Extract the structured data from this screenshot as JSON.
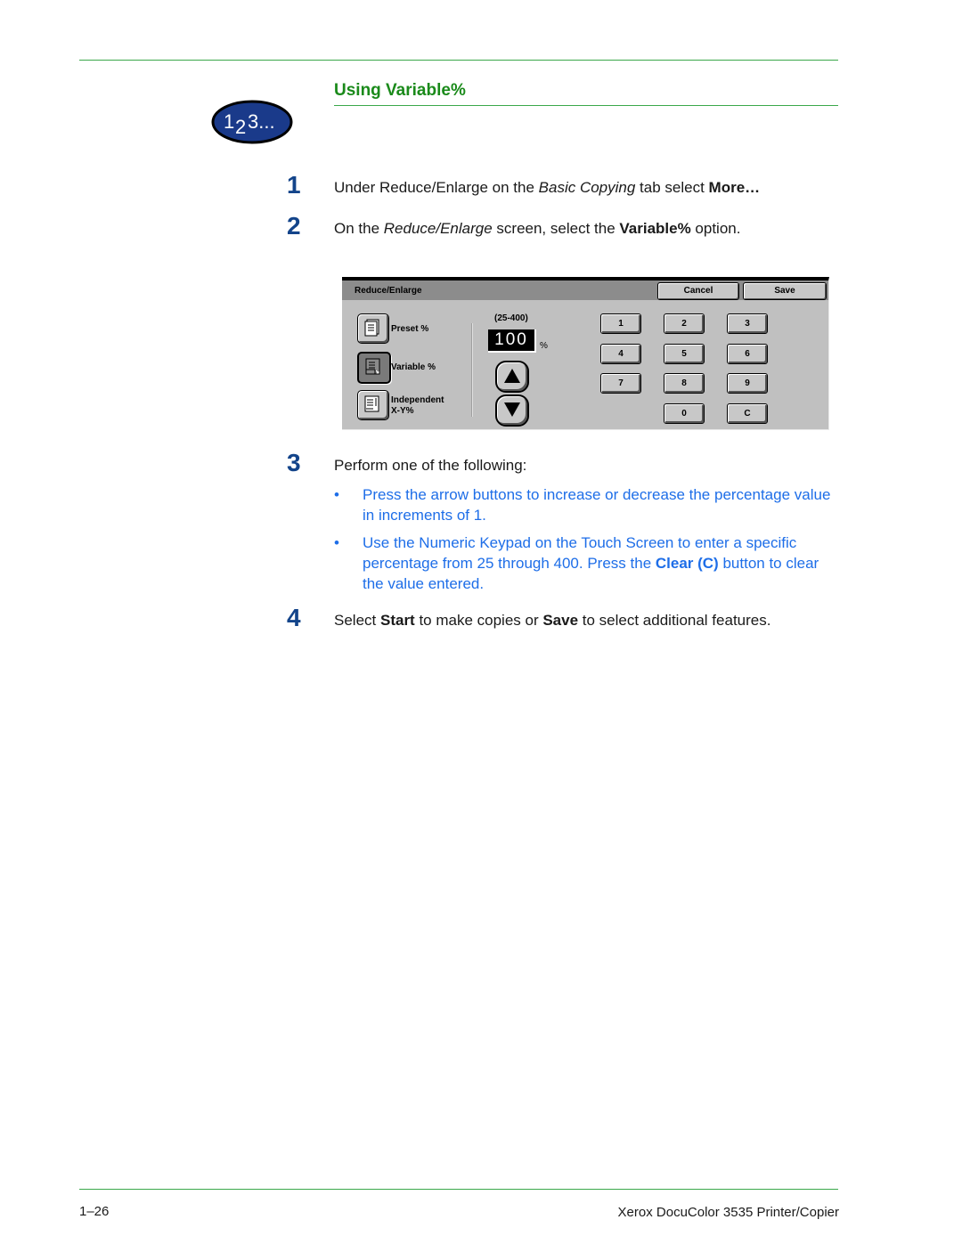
{
  "section": {
    "title": "Using Variable%",
    "badge_text": "123..."
  },
  "steps": [
    {
      "number": "1",
      "parts": {
        "a": "Under Reduce/Enlarge on the ",
        "b_italic": "Basic Copying",
        "c": " tab select ",
        "d_bold": "More…"
      }
    },
    {
      "number": "2",
      "parts": {
        "a": "On the ",
        "b_italic": "Reduce/Enlarge",
        "c": " screen, select the ",
        "d_bold": "Variable%",
        "e": " option."
      }
    },
    {
      "number": "3",
      "text": "Perform one of the following:"
    },
    {
      "number": "4",
      "parts": {
        "a": "Select ",
        "b_bold": "Start",
        "c": " to make copies or ",
        "d_bold": "Save",
        "e": " to select additional features."
      }
    }
  ],
  "bullets": [
    {
      "marker": "•",
      "text": "Press the arrow buttons to increase or decrease the percentage value in increments of 1."
    },
    {
      "marker": "•",
      "text_a": "Use the Numeric Keypad on the Touch Screen to enter a specific percentage from 25 through 400.  Press the ",
      "text_bold": "Clear (C)",
      "text_b": " button to clear the value entered."
    }
  ],
  "screen": {
    "title": "Reduce/Enlarge",
    "cancel_label": "Cancel",
    "save_label": "Save",
    "options": [
      {
        "label_line1": "Preset  %",
        "label_line2": "",
        "selected": false
      },
      {
        "label_line1": "Variable  %",
        "label_line2": "",
        "selected": true
      },
      {
        "label_line1": "Independent",
        "label_line2": "X-Y%",
        "selected": false
      }
    ],
    "range_label": "(25-400)",
    "value": "100",
    "unit": "%",
    "keypad": [
      "1",
      "2",
      "3",
      "4",
      "5",
      "6",
      "7",
      "8",
      "9",
      "0",
      "C"
    ]
  },
  "footer": {
    "page_number": "1–26",
    "product": "Xerox DocuColor 3535 Printer/Copier"
  },
  "colors": {
    "heading_green": "#1a8a1a",
    "rule_green": "#3aa84a",
    "step_number_blue": "#13448a",
    "bullet_blue": "#1e6ee8",
    "badge_navy": "#1a3a8a"
  }
}
